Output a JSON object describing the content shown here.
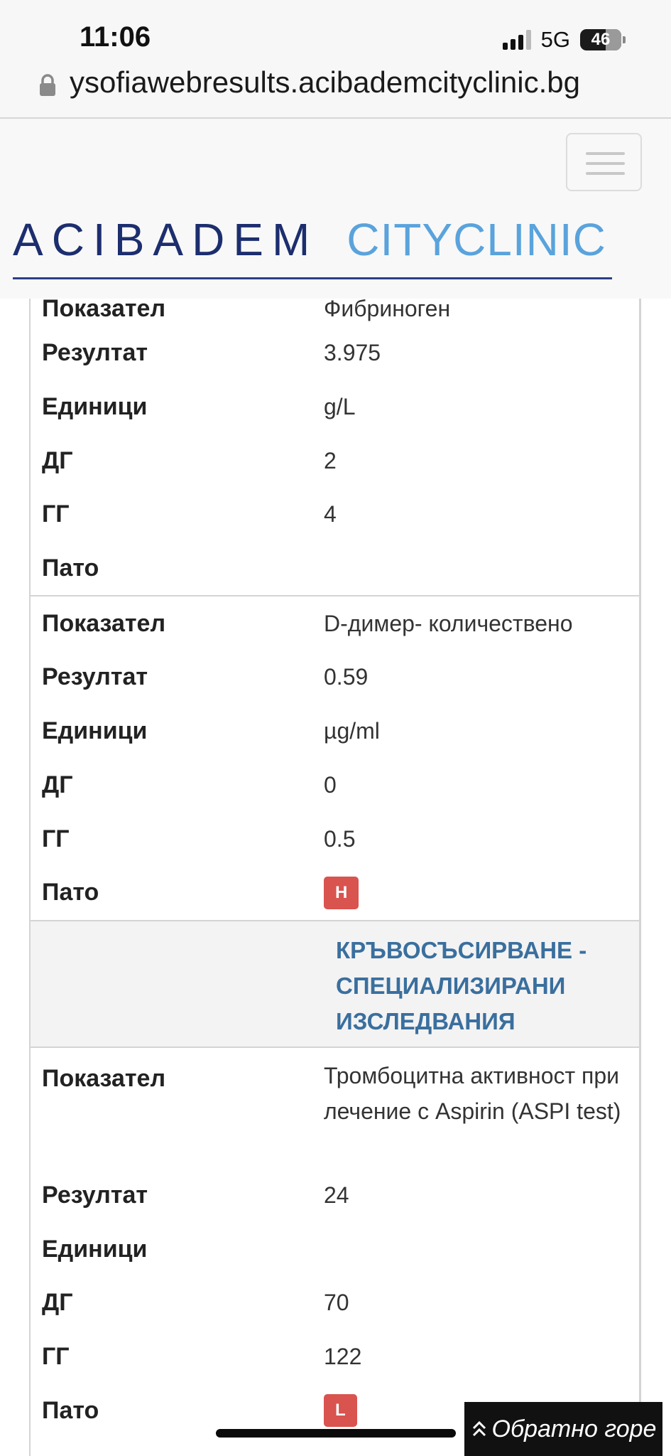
{
  "status_bar": {
    "time": "11:06",
    "network": "5G",
    "battery": "46"
  },
  "browser": {
    "url": "ysofiawebresults.acibademcityclinic.bg"
  },
  "header": {
    "logo_left": "ACIBADEM",
    "logo_right": "CITYCLINIC"
  },
  "results": [
    {
      "rows": [
        {
          "label": "Показател",
          "value": "Фибриноген"
        },
        {
          "label": "Резултат",
          "value": "3.975"
        },
        {
          "label": "Единици",
          "value": "g/L"
        },
        {
          "label": "ДГ",
          "value": "2"
        },
        {
          "label": "ГГ",
          "value": "4"
        },
        {
          "label": "Пато",
          "value": ""
        }
      ]
    },
    {
      "rows": [
        {
          "label": "Показател",
          "value": "D-димер- количествено"
        },
        {
          "label": "Резултат",
          "value": "0.59"
        },
        {
          "label": "Единици",
          "value": "µg/ml"
        },
        {
          "label": "ДГ",
          "value": "0"
        },
        {
          "label": "ГГ",
          "value": "0.5"
        },
        {
          "label": "Пато",
          "badge": "H"
        }
      ]
    }
  ],
  "section": {
    "title": "КРЪВОСЪСИРВАНЕ - СПЕЦИАЛИЗИРАНИ ИЗСЛЕДВАНИЯ"
  },
  "results2": [
    {
      "rows": [
        {
          "label": "Показател",
          "value": "Тромбоцитна активност при лечение с Aspirin (ASPI test)"
        },
        {
          "label": "Резултат",
          "value": "24"
        },
        {
          "label": "Единици",
          "value": ""
        },
        {
          "label": "ДГ",
          "value": "70"
        },
        {
          "label": "ГГ",
          "value": "122"
        },
        {
          "label": "Пато",
          "badge": "L"
        }
      ]
    }
  ],
  "back_to_top": {
    "label": "Обратно горе",
    "icon": "double-chevron-up-icon"
  },
  "colors": {
    "badge": "#d9534f",
    "section_title": "#3a6f9e",
    "logo_dark": "#1c2e6e",
    "logo_light": "#5aa3dc"
  }
}
